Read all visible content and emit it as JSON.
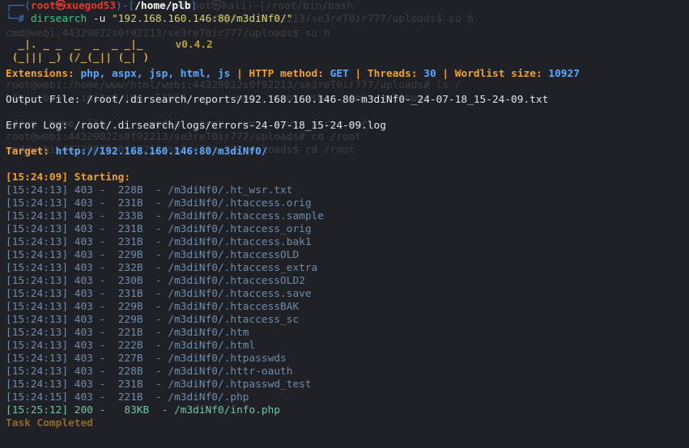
{
  "prompt": {
    "frame_top": "┌──(",
    "user": "root㉿xuegod53",
    "frame_mid": ")-[",
    "cwd": "/home/plb",
    "frame_end": "]",
    "frame_bottom": "└─# ",
    "cmd_bin": "dirsearch",
    "cmd_flag": " -u ",
    "cmd_arg": "\"192.168.160.146:80/m3diNf0/\""
  },
  "banner": {
    "line1": "  _|. _ _  _  _  _ _|_",
    "line2": " (_||| _) (/_(_|| (_| )",
    "version": "v0.4.2"
  },
  "config": {
    "ext_label": "Extensions: ",
    "ext_value": "php, aspx, jsp, html, js",
    "sep": " | ",
    "method_label": "HTTP method: ",
    "method_value": "GET",
    "threads_label": "Threads: ",
    "threads_value": "30",
    "wordlist_label": "Wordlist size: ",
    "wordlist_value": "10927"
  },
  "output_file": "Output File: /root/.dirsearch/reports/192.168.160.146-80-m3diNf0-_24-07-18_15-24-09.txt",
  "error_log": "Error Log: /root/.dirsearch/logs/errors-24-07-18_15-24-09.log",
  "target": {
    "label": "Target: ",
    "url": "http://192.168.160.146:80/m3diNf0/"
  },
  "starting": "[15:24:09] Starting:",
  "results": [
    {
      "time": "[15:24:13]",
      "code": "403",
      "size": " 228B",
      "path": "/m3diNf0/.ht_wsr.txt"
    },
    {
      "time": "[15:24:13]",
      "code": "403",
      "size": " 231B",
      "path": "/m3diNf0/.htaccess.orig"
    },
    {
      "time": "[15:24:13]",
      "code": "403",
      "size": " 233B",
      "path": "/m3diNf0/.htaccess.sample"
    },
    {
      "time": "[15:24:13]",
      "code": "403",
      "size": " 231B",
      "path": "/m3diNf0/.htaccess_orig"
    },
    {
      "time": "[15:24:13]",
      "code": "403",
      "size": " 231B",
      "path": "/m3diNf0/.htaccess.bak1"
    },
    {
      "time": "[15:24:13]",
      "code": "403",
      "size": " 229B",
      "path": "/m3diNf0/.htaccessOLD"
    },
    {
      "time": "[15:24:13]",
      "code": "403",
      "size": " 232B",
      "path": "/m3diNf0/.htaccess_extra"
    },
    {
      "time": "[15:24:13]",
      "code": "403",
      "size": " 230B",
      "path": "/m3diNf0/.htaccessOLD2"
    },
    {
      "time": "[15:24:13]",
      "code": "403",
      "size": " 231B",
      "path": "/m3diNf0/.htaccess.save"
    },
    {
      "time": "[15:24:13]",
      "code": "403",
      "size": " 229B",
      "path": "/m3diNf0/.htaccessBAK"
    },
    {
      "time": "[15:24:13]",
      "code": "403",
      "size": " 229B",
      "path": "/m3diNf0/.htaccess_sc"
    },
    {
      "time": "[15:24:13]",
      "code": "403",
      "size": " 221B",
      "path": "/m3diNf0/.htm"
    },
    {
      "time": "[15:24:13]",
      "code": "403",
      "size": " 222B",
      "path": "/m3diNf0/.html"
    },
    {
      "time": "[15:24:13]",
      "code": "403",
      "size": " 227B",
      "path": "/m3diNf0/.htpasswds"
    },
    {
      "time": "[15:24:13]",
      "code": "403",
      "size": " 228B",
      "path": "/m3diNf0/.httr-oauth"
    },
    {
      "time": "[15:24:13]",
      "code": "403",
      "size": " 231B",
      "path": "/m3diNf0/.htpasswd_test"
    },
    {
      "time": "[15:24:15]",
      "code": "403",
      "size": " 221B",
      "path": "/m3diNf0/.php"
    },
    {
      "time": "[15:25:12]",
      "code": "200",
      "size": "  83KB",
      "path": "/m3diNf0/info.php"
    }
  ],
  "task_completed": "Task Completed",
  "ghost": [
    "                          ──(root㉿kali)-[/root/bin/bash",
    "                                 ##@#:/d/0f92213/se3reT0ir777/uploads$ su h",
    "cmd@webi:44329022s0f92213/se3reT0ir777/uploads$ su h",
    "root@webi:/home/www/html/webi:44329022s0f92213/se3reT0ir777/uploads# ls /",
    "bin   boot  initrd.img  lib64        mnt   root  sbin  tmp  vmlinuz",
    "cdrom  home  lib       media   proc  run   srv   usr   var",
    "root@webi:44329022s0f92213/se3reT0ir777/uploads# cd /root",
    "cmd@webi:44329022s0f92213/se3reT0ir777/uploads$ cd /root"
  ]
}
